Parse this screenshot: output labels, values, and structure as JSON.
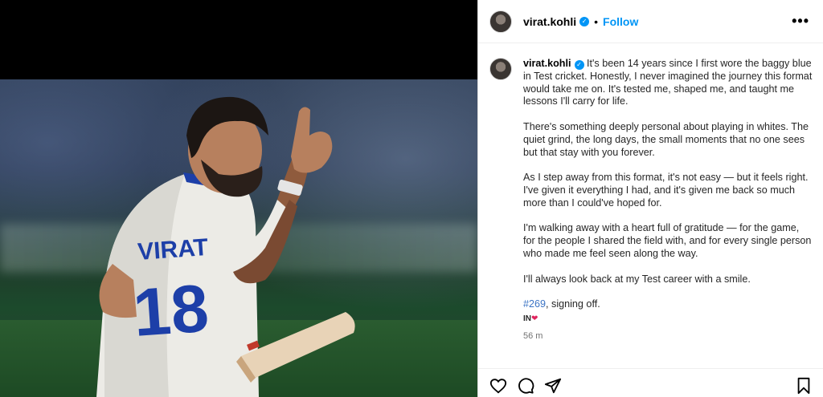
{
  "post": {
    "username": "virat.kohli",
    "follow_label": "Follow",
    "dot": "•",
    "more_label": "•••",
    "verified_mark": "✓",
    "caption": {
      "p1": "It's been 14 years since I first wore the baggy blue in Test cricket. Honestly, I never imagined the journey this format would take me on. It's tested me, shaped me, and taught me lessons I'll carry for life.",
      "p2": "There's something deeply personal about playing in whites. The quiet grind, the long days, the small moments that no one sees but that stay with you forever.",
      "p3": "As I step away from this format, it's not easy — but it feels right. I've given it everything I had, and it's given me back so much more than I could've hoped for.",
      "p4": "I'm walking away with a heart full of gratitude — for the game, for the people I shared the field with, and for every single person who made me feel seen along the way.",
      "p5": "I'll always look back at my Test career with a smile.",
      "hashtag": "#269",
      "signoff": ", signing off.",
      "flag": "IN",
      "heart": "❤"
    },
    "time_ago": "56 m"
  },
  "photo": {
    "jersey_name": "VIRAT",
    "jersey_number": "18"
  },
  "icons": [
    "more-icon",
    "like-icon",
    "comment-icon",
    "share-icon",
    "save-icon"
  ],
  "colors": {
    "accent": "#0095f6",
    "hashtag": "#3b73c4",
    "heart": "#e0245e",
    "jersey_text": "#1d3fa8"
  }
}
